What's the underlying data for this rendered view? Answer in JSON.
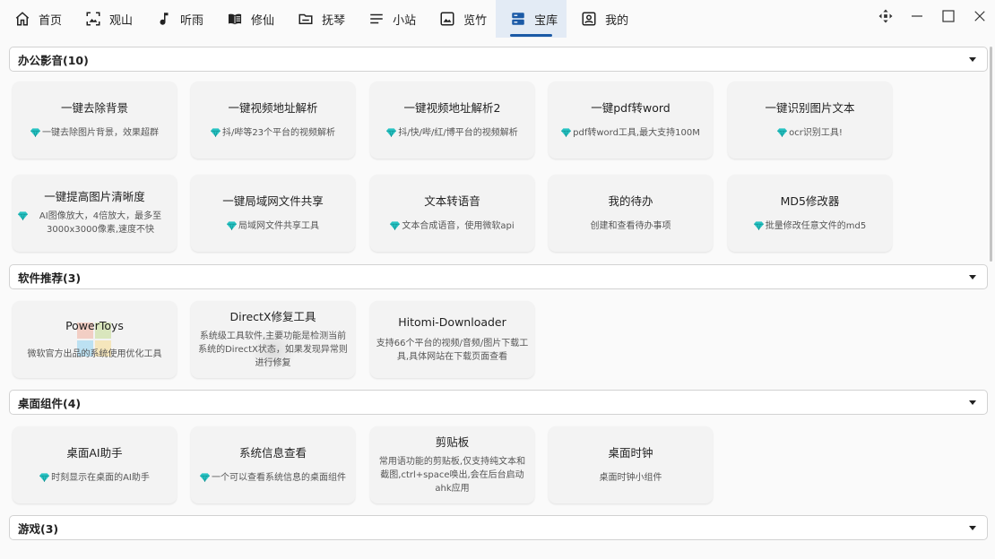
{
  "nav": {
    "tabs": [
      {
        "label": "首页",
        "icon": "home-icon"
      },
      {
        "label": "观山",
        "icon": "image-frame-icon"
      },
      {
        "label": "听雨",
        "icon": "music-note-icon"
      },
      {
        "label": "修仙",
        "icon": "book-icon"
      },
      {
        "label": "抚琴",
        "icon": "folder-icon"
      },
      {
        "label": "小站",
        "icon": "menu-lines-icon"
      },
      {
        "label": "览竹",
        "icon": "picture-icon"
      },
      {
        "label": "宝库",
        "icon": "treasure-box-icon",
        "active": true
      },
      {
        "label": "我的",
        "icon": "user-card-icon"
      }
    ],
    "accent": "#1b5aa6"
  },
  "window_controls": [
    "move-icon",
    "minimize-icon",
    "maximize-icon",
    "close-icon"
  ],
  "sections": [
    {
      "title": "办公影音(10)",
      "cards": [
        {
          "title": "一键去除背景",
          "desc": "一键去除图片背景，效果超群",
          "gem": true
        },
        {
          "title": "一键视频地址解析",
          "desc": "抖/哔等23个平台的视频解析",
          "gem": true
        },
        {
          "title": "一键视频地址解析2",
          "desc": "抖/快/哔/红/博平台的视频解析",
          "gem": true
        },
        {
          "title": "一键pdf转word",
          "desc": "pdf转word工具,最大支持100M",
          "gem": true
        },
        {
          "title": "一键识别图片文本",
          "desc": "ocr识别工具!",
          "gem": true
        },
        {
          "title": "一键提高图片清晰度",
          "desc": "AI图像放大，4倍放大，最多至3000x3000像素,速度不快",
          "gem": true
        },
        {
          "title": "一键局域网文件共享",
          "desc": "局域网文件共享工具",
          "gem": true
        },
        {
          "title": "文本转语音",
          "desc": "文本合成语音，使用微软api",
          "gem": true
        },
        {
          "title": "我的待办",
          "desc": "创建和查看待办事项",
          "gem": false
        },
        {
          "title": "MD5修改器",
          "desc": "批量修改任意文件的md5",
          "gem": true
        }
      ]
    },
    {
      "title": "软件推荐(3)",
      "cards": [
        {
          "title": "PowerToys",
          "desc": "微软官方出品的系统使用优化工具",
          "gem": false
        },
        {
          "title": "DirectX修复工具",
          "desc": "系统级工具软件,主要功能是检测当前系统的DirectX状态，如果发现异常则进行修复",
          "gem": false
        },
        {
          "title": "Hitomi-Downloader",
          "desc": "支持66个平台的视频/音频/图片下载工具,具体网站在下载页面查看",
          "gem": false
        }
      ]
    },
    {
      "title": "桌面组件(4)",
      "cards": [
        {
          "title": "桌面AI助手",
          "desc": "时刻显示在桌面的AI助手",
          "gem": true
        },
        {
          "title": "系统信息查看",
          "desc": "一个可以查看系统信息的桌面组件",
          "gem": true
        },
        {
          "title": "剪贴板",
          "desc": "常用语功能的剪贴板,仅支持纯文本和截图,ctrl+space唤出,会在后台启动ahk应用",
          "gem": false
        },
        {
          "title": "桌面时钟",
          "desc": "桌面时钟小组件",
          "gem": false
        }
      ]
    },
    {
      "title": "游戏(3)",
      "cards": []
    }
  ]
}
